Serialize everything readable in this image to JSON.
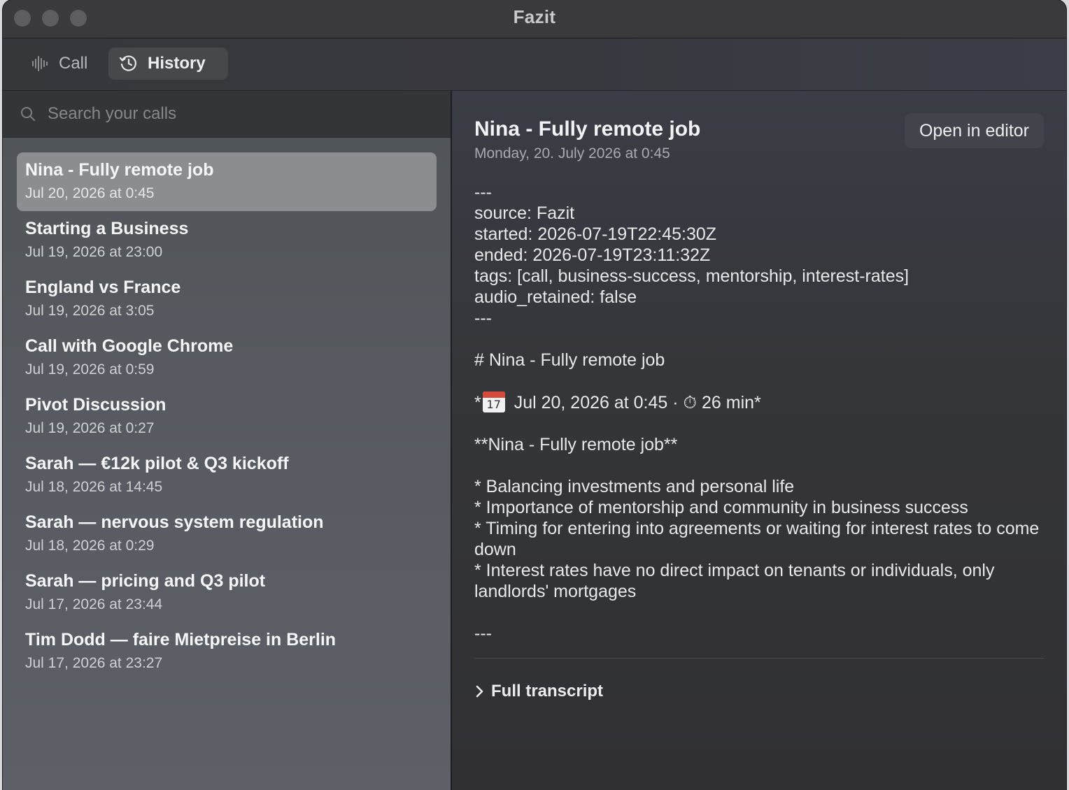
{
  "window": {
    "title": "Fazit"
  },
  "toolbar": {
    "tabs": [
      {
        "label": "Call",
        "icon": "waveform-icon"
      },
      {
        "label": "History",
        "icon": "clock-history-icon",
        "selected": true
      }
    ]
  },
  "sidebar": {
    "search_placeholder": "Search your calls",
    "items": [
      {
        "title": "Nina - Fully remote job",
        "date": "Jul 20, 2026 at 0:45",
        "selected": true
      },
      {
        "title": "Starting a Business",
        "date": "Jul 19, 2026 at 23:00"
      },
      {
        "title": "England vs France",
        "date": "Jul 19, 2026 at 3:05"
      },
      {
        "title": "Call with Google Chrome",
        "date": "Jul 19, 2026 at 0:59"
      },
      {
        "title": "Pivot Discussion",
        "date": "Jul 19, 2026 at 0:27"
      },
      {
        "title": "Sarah — €12k pilot & Q3 kickoff",
        "date": "Jul 18, 2026 at 14:45"
      },
      {
        "title": "Sarah — nervous system regulation",
        "date": "Jul 18, 2026 at 0:29"
      },
      {
        "title": "Sarah — pricing and Q3 pilot",
        "date": "Jul 17, 2026 at 23:44"
      },
      {
        "title": "Tim Dodd — faire Mietpreise in Berlin",
        "date": "Jul 17, 2026 at 23:27"
      }
    ]
  },
  "detail": {
    "title": "Nina - Fully remote job",
    "date": "Monday, 20. July 2026 at 0:45",
    "open_button": "Open in editor",
    "frontmatter": {
      "sep_open": "---",
      "source": "source: Fazit",
      "started": "started: 2026-07-19T22:45:30Z",
      "ended": "ended: 2026-07-19T23:11:32Z",
      "tags": "tags: [call, business-success, mentorship, interest-rates]",
      "audio": "audio_retained: false",
      "sep_close": "---"
    },
    "heading": "# Nina - Fully remote job",
    "meta": {
      "prefix": "*",
      "calendar_day": "17",
      "date": "Jul 20, 2026 at 0:45",
      "dot": "·",
      "timer": "⏱",
      "duration": "26 min*"
    },
    "bold_title": "**Nina - Fully remote job**",
    "bullets": [
      "* Balancing investments and personal life",
      "* Importance of mentorship and community in business success",
      "* Timing for entering into agreements or waiting for interest rates to come down",
      "* Interest rates have no direct impact on tenants or individuals, only landlords' mortgages"
    ],
    "end_sep": "---",
    "transcript_label": "Full transcript"
  }
}
